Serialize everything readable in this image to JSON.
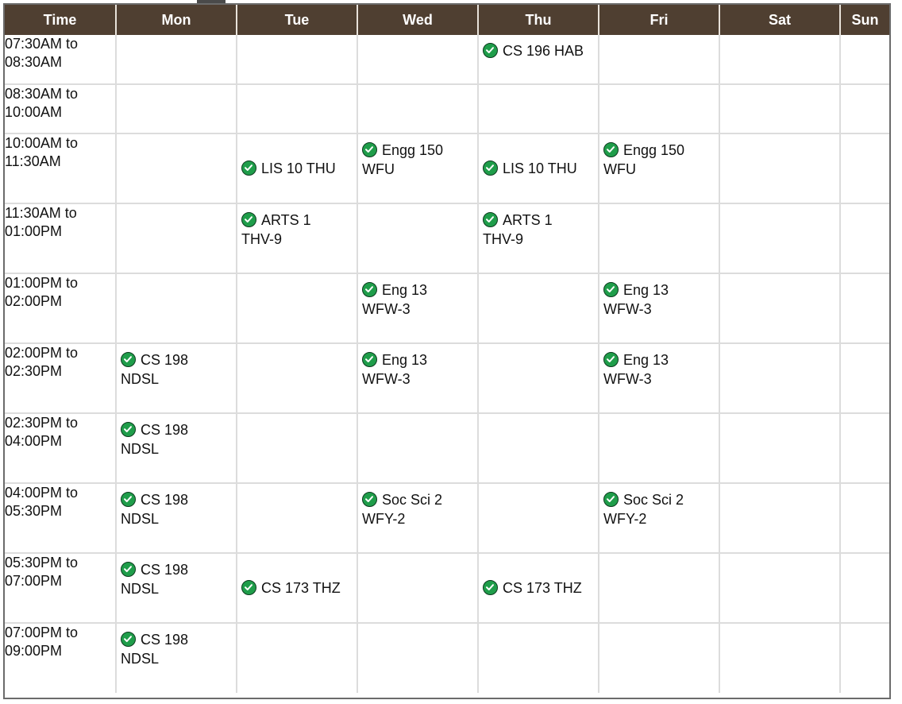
{
  "header": {
    "time": "Time",
    "days": [
      "Mon",
      "Tue",
      "Wed",
      "Thu",
      "Fri",
      "Sat",
      "Sun"
    ]
  },
  "rows": [
    {
      "time_start": "07:30AM to",
      "time_end": "08:30AM",
      "cells": [
        null,
        null,
        null,
        {
          "text": "CS 196 HAB",
          "single_line": true
        },
        null,
        null,
        null
      ]
    },
    {
      "time_start": "08:30AM to",
      "time_end": "10:00AM",
      "cells": [
        null,
        null,
        null,
        null,
        null,
        null,
        null
      ]
    },
    {
      "time_start": "10:00AM to",
      "time_end": "11:30AM",
      "cells": [
        null,
        {
          "text": "LIS 10 THU",
          "single_line": true,
          "middle": true
        },
        {
          "line1": "Engg 150",
          "line2": "WFU"
        },
        {
          "text": "LIS 10 THU",
          "single_line": true,
          "middle": true
        },
        {
          "line1": "Engg 150",
          "line2": "WFU"
        },
        null,
        null
      ]
    },
    {
      "time_start": "11:30AM to",
      "time_end": "01:00PM",
      "cells": [
        null,
        {
          "line1": "ARTS 1",
          "line2": "THV-9"
        },
        null,
        {
          "line1": "ARTS 1",
          "line2": "THV-9"
        },
        null,
        null,
        null
      ]
    },
    {
      "time_start": "01:00PM to",
      "time_end": "02:00PM",
      "cells": [
        null,
        null,
        {
          "line1": "Eng 13",
          "line2": "WFW-3"
        },
        null,
        {
          "line1": "Eng 13",
          "line2": "WFW-3"
        },
        null,
        null
      ]
    },
    {
      "time_start": "02:00PM to",
      "time_end": "02:30PM",
      "cells": [
        {
          "line1": "CS 198",
          "line2": "NDSL"
        },
        null,
        {
          "line1": "Eng 13",
          "line2": "WFW-3"
        },
        null,
        {
          "line1": "Eng 13",
          "line2": "WFW-3"
        },
        null,
        null
      ]
    },
    {
      "time_start": "02:30PM to",
      "time_end": "04:00PM",
      "cells": [
        {
          "line1": "CS 198",
          "line2": "NDSL"
        },
        null,
        null,
        null,
        null,
        null,
        null
      ]
    },
    {
      "time_start": "04:00PM to",
      "time_end": "05:30PM",
      "cells": [
        {
          "line1": "CS 198",
          "line2": "NDSL"
        },
        null,
        {
          "line1": "Soc Sci 2",
          "line2": "WFY-2"
        },
        null,
        {
          "line1": "Soc Sci 2",
          "line2": "WFY-2"
        },
        null,
        null
      ]
    },
    {
      "time_start": "05:30PM to",
      "time_end": "07:00PM",
      "cells": [
        {
          "line1": "CS 198",
          "line2": "NDSL"
        },
        {
          "text": "CS 173 THZ",
          "single_line": true,
          "middle": true
        },
        null,
        {
          "text": "CS 173 THZ",
          "single_line": true,
          "middle": true
        },
        null,
        null,
        null
      ]
    },
    {
      "time_start": "07:00PM to",
      "time_end": "09:00PM",
      "cells": [
        {
          "line1": "CS 198",
          "line2": "NDSL"
        },
        null,
        null,
        null,
        null,
        null,
        null
      ]
    }
  ],
  "colors": {
    "header_bg": "#4f3f31",
    "check": "#1f9d4a"
  }
}
